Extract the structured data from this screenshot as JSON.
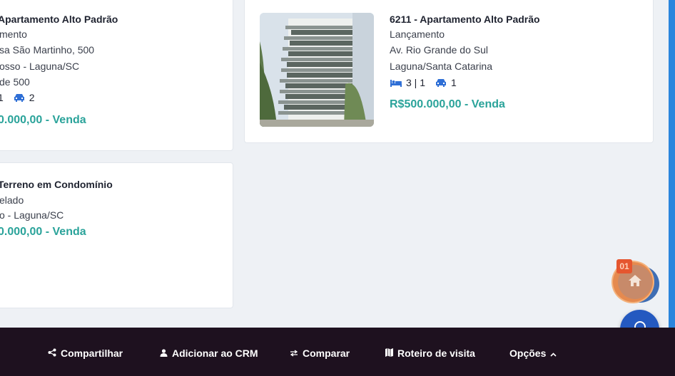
{
  "listings": [
    {
      "title": "Apartamento Alto Padrão",
      "status": "mento",
      "address": "sa São Martinho, 500",
      "district": "osso - Laguna/SC",
      "extra": "de 500",
      "beds": "1",
      "parking": "2",
      "price": "0.000,00 - Venda"
    },
    {
      "title": "Terreno em Condomínio",
      "status": "elado",
      "district": "o - Laguna/SC",
      "price": "0.000,00 - Venda"
    },
    {
      "title": "6211 - Apartamento Alto Padrão",
      "status": "Lançamento",
      "address": "Av. Rio Grande do Sul",
      "city": "Laguna/Santa Catarina",
      "beds": "3 | 1",
      "parking": "1",
      "price": "R$500.000,00 - Venda"
    }
  ],
  "bottom_bar": {
    "share": "Compartilhar",
    "crm": "Adicionar ao CRM",
    "compare": "Comparar",
    "route": "Roteiro de visita",
    "options": "Opções"
  },
  "fab": {
    "badge": "01"
  },
  "colors": {
    "price": "#2aa39a",
    "accent_blue": "#2a86dd",
    "bottom_bar": "#1e111f",
    "badge": "#e5562f"
  },
  "icons": [
    "bed-icon",
    "car-icon",
    "share-icon",
    "user-icon",
    "compare-icon",
    "map-icon",
    "chevron-up-icon",
    "home-icon",
    "headset-icon"
  ]
}
